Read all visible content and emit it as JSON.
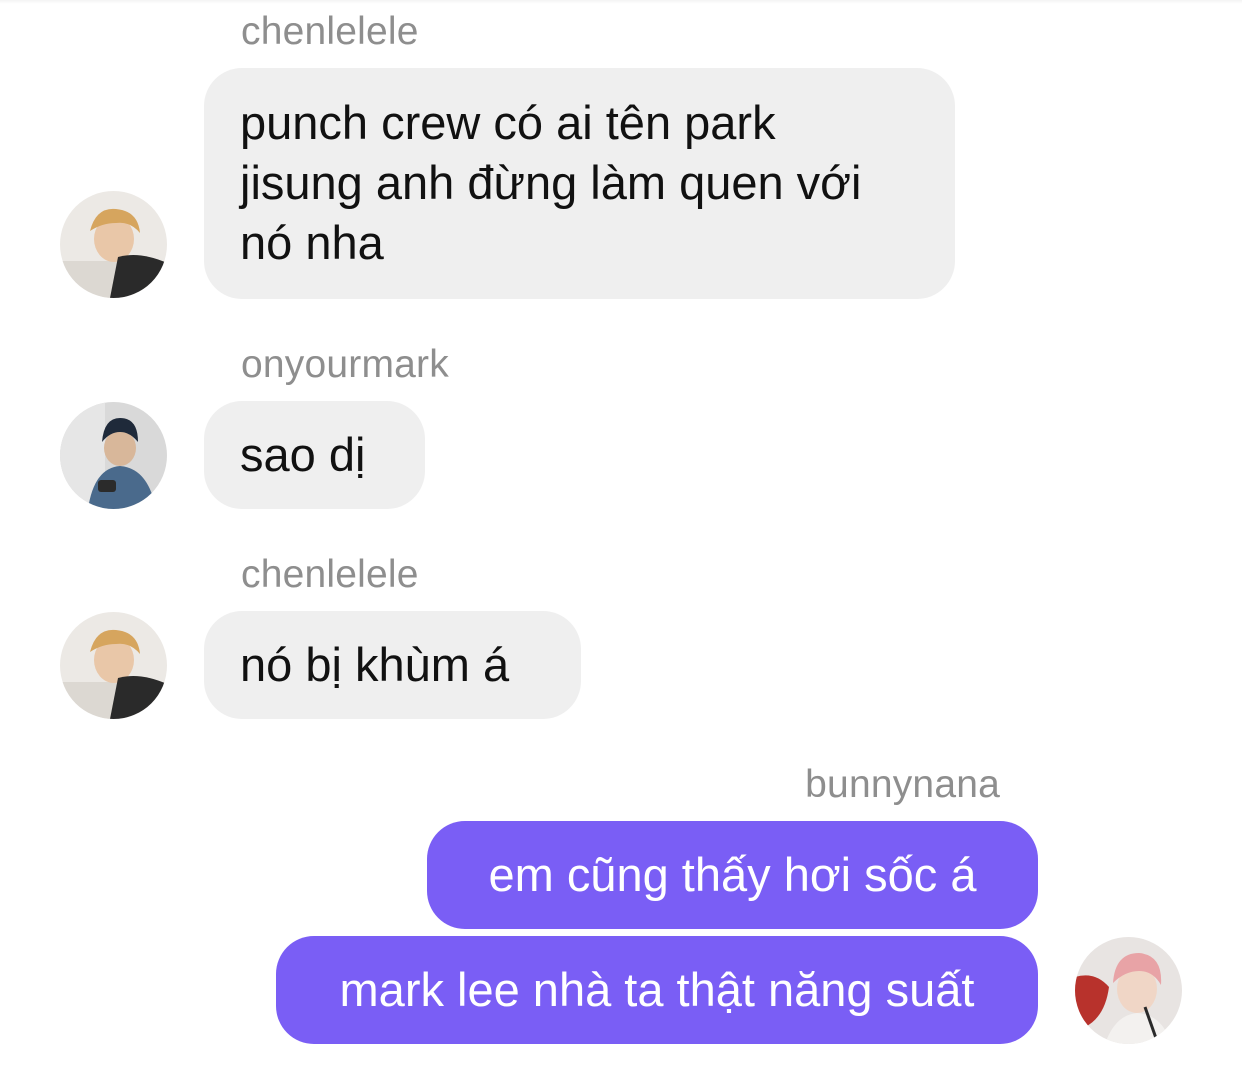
{
  "conversation": {
    "messages": [
      {
        "sender": "chenlelele",
        "direction": "incoming",
        "lines": [
          "punch crew có ai tên park",
          "jisung anh đừng làm quen với",
          "nó nha"
        ]
      },
      {
        "sender": "onyourmark",
        "direction": "incoming",
        "lines": [
          "sao dị"
        ]
      },
      {
        "sender": "chenlelele",
        "direction": "incoming",
        "lines": [
          "nó bị khùm á"
        ]
      },
      {
        "sender": "bunnynana",
        "direction": "outgoing",
        "lines": [
          "em cũng thấy hơi sốc á",
          "mark lee nhà ta thật năng suất"
        ]
      }
    ]
  },
  "colors": {
    "incoming_bubble": "#efefef",
    "outgoing_bubble": "#7a5ef5",
    "sender_label": "#8e8e8e"
  },
  "icons": {
    "avatar_chenlelele": "user-photo-avatar",
    "avatar_onyourmark": "user-photo-avatar",
    "avatar_bunnynana": "user-photo-avatar"
  }
}
